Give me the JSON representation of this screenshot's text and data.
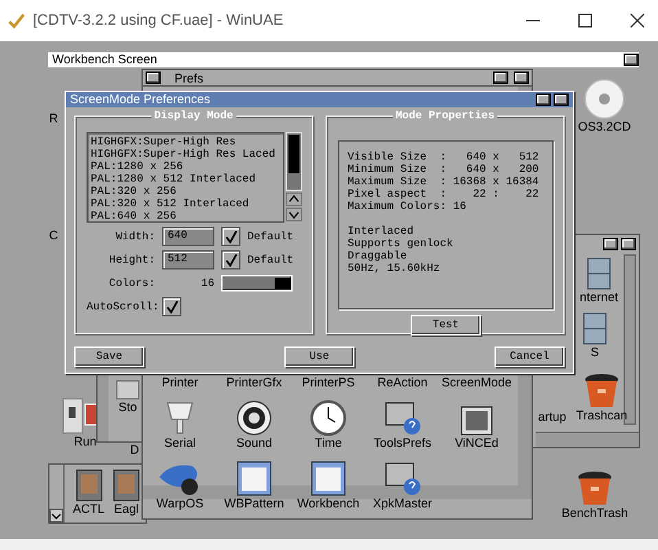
{
  "window": {
    "title": "[CDTV-3.2.2 using CF.uae] - WinUAE"
  },
  "screen_title": "Workbench Screen",
  "desktop_icons": [
    {
      "label": "R"
    },
    {
      "label": "C"
    },
    {
      "label": "OS3.2CD"
    },
    {
      "label": "Run"
    },
    {
      "label": "D"
    },
    {
      "label": "BenchTrash"
    }
  ],
  "left_window": {
    "icons": [
      {
        "label": "Sto"
      }
    ]
  },
  "dock_window": {
    "icons": [
      {
        "label": "ACTL"
      },
      {
        "label": "Eagl"
      }
    ]
  },
  "drawer_window": {
    "icons": [
      {
        "label": "nternet"
      },
      {
        "label": "S"
      },
      {
        "label": "artup"
      },
      {
        "label": "Trashcan"
      }
    ]
  },
  "prefs_window": {
    "title": "Prefs",
    "icons": [
      {
        "label": "Printer"
      },
      {
        "label": "PrinterGfx"
      },
      {
        "label": "PrinterPS"
      },
      {
        "label": "ReAction"
      },
      {
        "label": "ScreenMode"
      },
      {
        "label": "Serial"
      },
      {
        "label": "Sound"
      },
      {
        "label": "Time"
      },
      {
        "label": "ToolsPrefs"
      },
      {
        "label": "ViNCEd"
      },
      {
        "label": "WarpOS"
      },
      {
        "label": "WBPattern"
      },
      {
        "label": "Workbench"
      },
      {
        "label": "XpkMaster"
      }
    ]
  },
  "dialog": {
    "title": "ScreenMode Preferences",
    "display_mode": {
      "title": "Display Mode",
      "modes": [
        "HIGHGFX:Super-High Res",
        "HIGHGFX:Super-High Res Laced",
        "PAL:1280 x 256",
        "PAL:1280 x 512 Interlaced",
        "PAL:320 x 256",
        "PAL:320 x 512 Interlaced",
        "PAL:640 x 256"
      ],
      "width": {
        "label": "Width:",
        "value": "640",
        "default_label": "Default",
        "default_checked": true
      },
      "height": {
        "label": "Height:",
        "value": "512",
        "default_label": "Default",
        "default_checked": true
      },
      "colors": {
        "label": "Colors:",
        "value": "16",
        "level": 1
      },
      "autoscroll": {
        "label": "AutoScroll:",
        "checked": true
      }
    },
    "mode_properties": {
      "title": "Mode Properties",
      "lines": [
        "Visible Size  :   640 x   512",
        "Minimum Size  :   640 x   200",
        "Maximum Size  : 16368 x 16384",
        "Pixel aspect  :    22 :    22",
        "Maximum Colors: 16"
      ],
      "flags": [
        "Interlaced",
        "Supports genlock",
        "Draggable",
        "50Hz, 15.60kHz"
      ],
      "test_button": "Test"
    },
    "buttons": [
      "Save",
      "Use",
      "Cancel"
    ]
  }
}
